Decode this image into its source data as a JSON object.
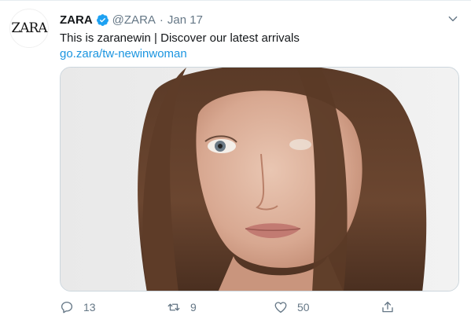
{
  "tweet": {
    "avatar_text": "ZARA",
    "name": "ZARA",
    "handle": "@ZARA",
    "separator": "·",
    "date": "Jan 17",
    "text": "This is zaranewin | Discover our latest arrivals",
    "link": "go.zara/tw-newinwoman",
    "media_description_icon": "photo-of-woman-with-brown-hair",
    "stats": {
      "replies": "13",
      "retweets": "9",
      "likes": "50"
    }
  },
  "colors": {
    "accent": "#1b95e0",
    "muted": "#657786",
    "verified": "#1da1f2"
  }
}
